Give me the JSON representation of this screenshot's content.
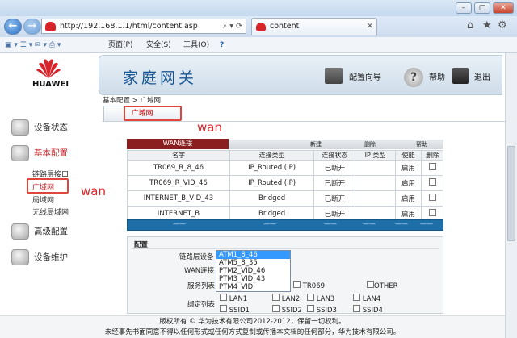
{
  "browser": {
    "address": "http://192.168.1.1/html/content.asp",
    "tab_title": "content",
    "menu": {
      "page": "页面(P)",
      "safety": "安全(S)",
      "tools": "工具(O)",
      "help": "?"
    }
  },
  "header": {
    "brand": "HUAWEI",
    "title": "家庭网关",
    "config_wizard": "配置向导",
    "help": "帮助",
    "logout": "退出"
  },
  "breadcrumb": "基本配置 > 广域网",
  "subtab": "广域网",
  "annotation_wan_top": "wan",
  "annotation_wan_side": "wan",
  "sidebar": {
    "device_status": "设备状态",
    "basic_config": "基本配置",
    "sub_items": [
      "链路层接口",
      "广域网",
      "局域网",
      "无线局域网"
    ],
    "advanced": "高级配置",
    "maintenance": "设备维护"
  },
  "wan": {
    "tab": "WAN连接",
    "actions": {
      "new": "新建",
      "delete": "删除",
      "help": "帮助"
    },
    "columns": [
      "名字",
      "连接类型",
      "连接状态",
      "IP 类型",
      "使能",
      "删除"
    ],
    "rows": [
      {
        "name": "TR069_R_8_46",
        "type": "IP_Routed (IP)",
        "status": "已断开",
        "ip": "",
        "enable": "启用"
      },
      {
        "name": "TR069_R_VID_46",
        "type": "IP_Routed (IP)",
        "status": "已断开",
        "ip": "",
        "enable": "启用"
      },
      {
        "name": "INTERNET_B_VID_43",
        "type": "Bridged",
        "status": "已断开",
        "ip": "",
        "enable": "启用"
      },
      {
        "name": "INTERNET_B",
        "type": "Bridged",
        "status": "已断开",
        "ip": "",
        "enable": "启用"
      }
    ],
    "blank_row": [
      "——",
      "——",
      "——",
      "——",
      "——",
      "——"
    ]
  },
  "config": {
    "title": "配置",
    "link_device_label": "链路层设备",
    "wan_conn_label": "WAN连接",
    "service_label": "服务列表",
    "bind_label": "绑定列表",
    "dropdown_options": [
      "ATM1_8_46",
      "ATM5_8_35",
      "PTM2_VID_46",
      "PTM3_VID_43",
      "PTM4_VID"
    ],
    "service_options": [
      "TR069",
      "OTHER"
    ],
    "lan_options": [
      "LAN1",
      "LAN2",
      "LAN3",
      "LAN4"
    ],
    "ssid_options": [
      "SSID1",
      "SSID2",
      "SSID3",
      "SSID4"
    ]
  },
  "footer": {
    "line1": "版权所有 © 华为技术有限公司2012-2012，保留一切权利。",
    "line2": "未经事先书面同意不得以任何形式或任何方式复制或传播本文档的任何部分，华为技术有限公司。"
  }
}
